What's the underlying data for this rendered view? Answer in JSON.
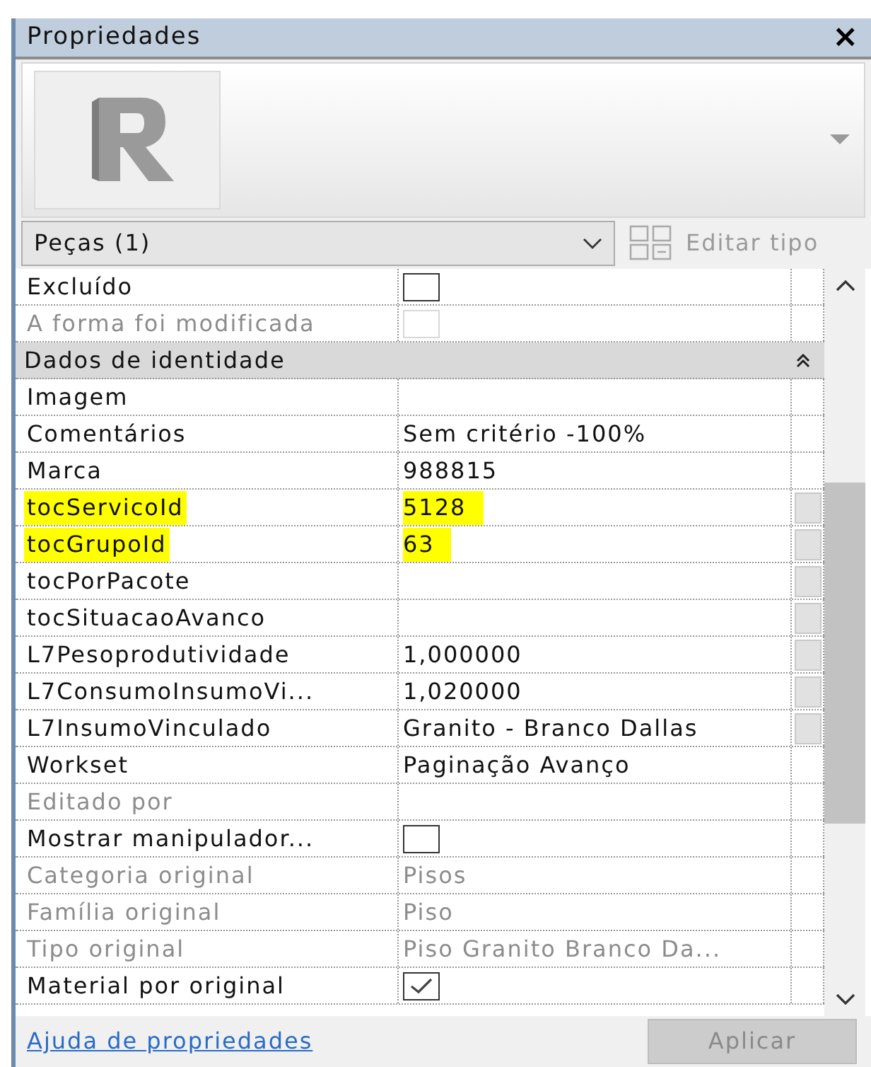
{
  "window": {
    "title": "Propriedades",
    "close": "×"
  },
  "type_selector": {
    "value": "Peças (1)"
  },
  "edit_type": {
    "label": "Editar tipo",
    "disabled": true
  },
  "rows": [
    {
      "kind": "checkbox",
      "name": "Excluído",
      "checked": false,
      "disabled": false,
      "highlighted": false,
      "has_button": false
    },
    {
      "kind": "checkbox",
      "name": "A forma foi modificada",
      "checked": false,
      "disabled": true,
      "highlighted": false,
      "has_button": false
    },
    {
      "kind": "header",
      "name": "Dados de identidade",
      "expanded": true
    },
    {
      "kind": "text",
      "name": "Imagem",
      "disabled": false,
      "highlighted": false,
      "has_button": false
    },
    {
      "kind": "text",
      "name": "Comentários",
      "value": "Sem critério -100%",
      "disabled": false,
      "highlighted": false,
      "has_button": false
    },
    {
      "kind": "text",
      "name": "Marca",
      "value": "988815",
      "disabled": false,
      "highlighted": false,
      "has_button": false
    },
    {
      "kind": "text",
      "name": "tocServicoId",
      "value": "5128",
      "disabled": false,
      "highlighted": true,
      "has_button": true
    },
    {
      "kind": "text",
      "name": "tocGrupoId",
      "value": "63",
      "disabled": false,
      "highlighted": true,
      "has_button": true
    },
    {
      "kind": "text",
      "name": "tocPorPacote",
      "disabled": false,
      "highlighted": false,
      "has_button": true
    },
    {
      "kind": "text",
      "name": "tocSituacaoAvanco",
      "disabled": false,
      "highlighted": false,
      "has_button": true
    },
    {
      "kind": "text",
      "name": "L7Pesoprodutividade",
      "value": "1,000000",
      "disabled": false,
      "highlighted": false,
      "has_button": true
    },
    {
      "kind": "text",
      "name": "L7ConsumoInsumoVi...",
      "value": "1,020000",
      "disabled": false,
      "highlighted": false,
      "has_button": true
    },
    {
      "kind": "text",
      "name": "L7InsumoVinculado",
      "value": "Granito - Branco Dallas",
      "disabled": false,
      "highlighted": false,
      "has_button": true
    },
    {
      "kind": "text",
      "name": "Workset",
      "value": "Paginação Avanço",
      "disabled": false,
      "highlighted": false,
      "has_button": false
    },
    {
      "kind": "text",
      "name": "Editado por",
      "disabled": true,
      "highlighted": false,
      "has_button": false
    },
    {
      "kind": "checkbox",
      "name": "Mostrar manipulador...",
      "checked": false,
      "disabled": false,
      "highlighted": false,
      "has_button": false
    },
    {
      "kind": "text",
      "name": "Categoria original",
      "value": "Pisos",
      "disabled": true,
      "highlighted": false,
      "has_button": false
    },
    {
      "kind": "text",
      "name": "Família original",
      "value": "Piso",
      "disabled": true,
      "highlighted": false,
      "has_button": false
    },
    {
      "kind": "text",
      "name": "Tipo original",
      "value": "Piso Granito Branco Da...",
      "disabled": true,
      "highlighted": false,
      "has_button": false
    },
    {
      "kind": "checkbox",
      "name": "Material por original",
      "checked": true,
      "disabled": false,
      "highlighted": false,
      "has_button": false
    }
  ],
  "footer": {
    "help_link": "Ajuda de propriedades",
    "apply": {
      "label": "Aplicar",
      "disabled": true
    }
  }
}
